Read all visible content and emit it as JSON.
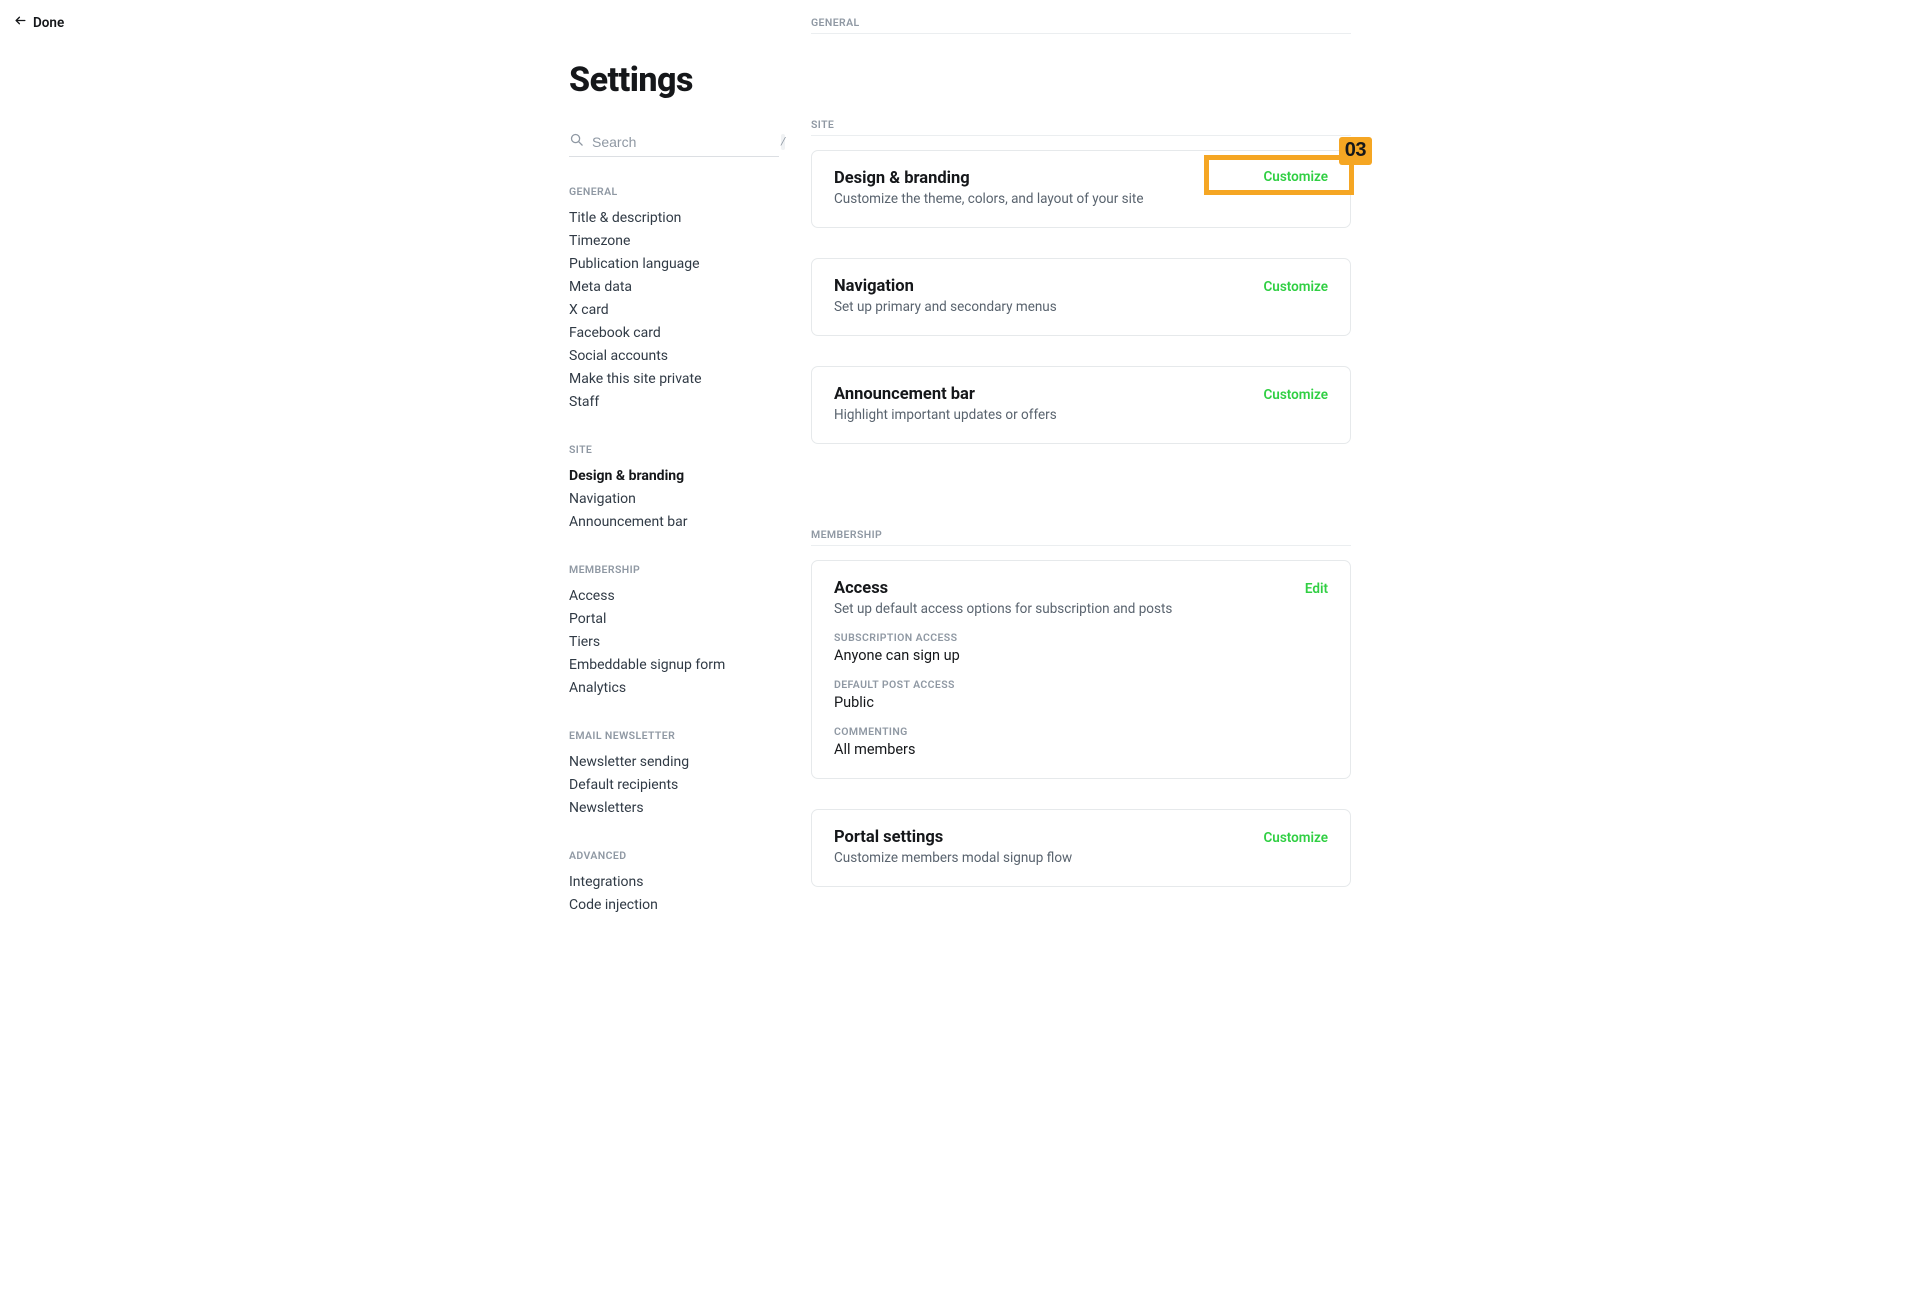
{
  "done_label": "Done",
  "page_title": "Settings",
  "search": {
    "placeholder": "Search",
    "shortcut": "/"
  },
  "sidebar": {
    "groups": [
      {
        "heading": "GENERAL",
        "items": [
          {
            "label": "Title & description",
            "name": "nav-title-description"
          },
          {
            "label": "Timezone",
            "name": "nav-timezone"
          },
          {
            "label": "Publication language",
            "name": "nav-publication-language"
          },
          {
            "label": "Meta data",
            "name": "nav-meta-data"
          },
          {
            "label": "X card",
            "name": "nav-x-card"
          },
          {
            "label": "Facebook card",
            "name": "nav-facebook-card"
          },
          {
            "label": "Social accounts",
            "name": "nav-social-accounts"
          },
          {
            "label": "Make this site private",
            "name": "nav-make-private"
          },
          {
            "label": "Staff",
            "name": "nav-staff"
          }
        ]
      },
      {
        "heading": "SITE",
        "items": [
          {
            "label": "Design & branding",
            "name": "nav-design-branding",
            "active": true
          },
          {
            "label": "Navigation",
            "name": "nav-navigation"
          },
          {
            "label": "Announcement bar",
            "name": "nav-announcement-bar"
          }
        ]
      },
      {
        "heading": "MEMBERSHIP",
        "items": [
          {
            "label": "Access",
            "name": "nav-access"
          },
          {
            "label": "Portal",
            "name": "nav-portal"
          },
          {
            "label": "Tiers",
            "name": "nav-tiers"
          },
          {
            "label": "Embeddable signup form",
            "name": "nav-embeddable-signup"
          },
          {
            "label": "Analytics",
            "name": "nav-analytics"
          }
        ]
      },
      {
        "heading": "EMAIL NEWSLETTER",
        "items": [
          {
            "label": "Newsletter sending",
            "name": "nav-newsletter-sending"
          },
          {
            "label": "Default recipients",
            "name": "nav-default-recipients"
          },
          {
            "label": "Newsletters",
            "name": "nav-newsletters"
          }
        ]
      },
      {
        "heading": "ADVANCED",
        "items": [
          {
            "label": "Integrations",
            "name": "nav-integrations"
          },
          {
            "label": "Code injection",
            "name": "nav-code-injection"
          }
        ]
      }
    ]
  },
  "main": {
    "general_label": "GENERAL",
    "site_label": "SITE",
    "membership_label": "MEMBERSHIP",
    "cards": {
      "design": {
        "title": "Design & branding",
        "desc": "Customize the theme, colors, and layout of your site",
        "action": "Customize"
      },
      "navigation": {
        "title": "Navigation",
        "desc": "Set up primary and secondary menus",
        "action": "Customize"
      },
      "announcement": {
        "title": "Announcement bar",
        "desc": "Highlight important updates or offers",
        "action": "Customize"
      },
      "access": {
        "title": "Access",
        "desc": "Set up default access options for subscription and posts",
        "action": "Edit",
        "fields": [
          {
            "label": "SUBSCRIPTION ACCESS",
            "value": "Anyone can sign up"
          },
          {
            "label": "DEFAULT POST ACCESS",
            "value": "Public"
          },
          {
            "label": "COMMENTING",
            "value": "All members"
          }
        ]
      },
      "portal": {
        "title": "Portal settings",
        "desc": "Customize members modal signup flow",
        "action": "Customize"
      }
    }
  },
  "annotation": {
    "number": "03"
  }
}
